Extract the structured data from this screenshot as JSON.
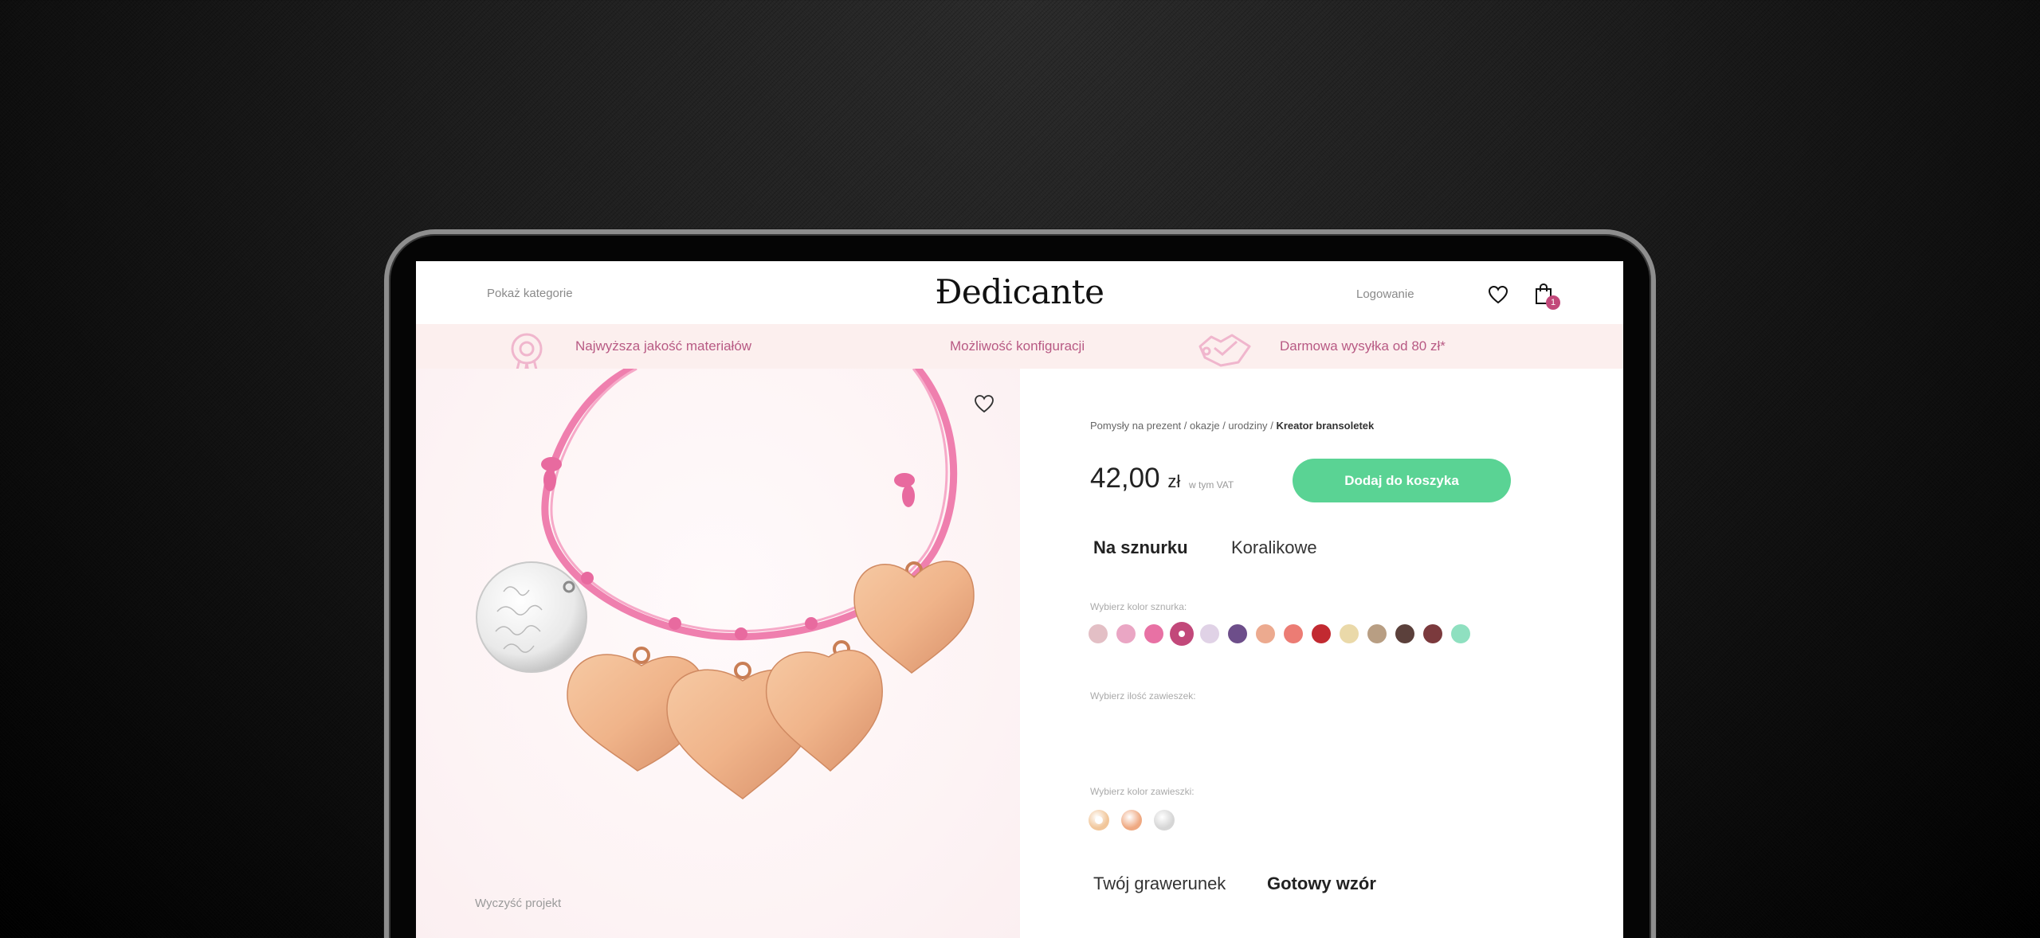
{
  "header": {
    "show_categories": "Pokaż kategorie",
    "logo": "Ðedicante",
    "login": "Logowanie",
    "cart_count": "1"
  },
  "benefits": [
    {
      "label": "Najwyższa jakość materiałów",
      "icon": "award-icon"
    },
    {
      "label": "Możliwość konfiguracji"
    },
    {
      "label": "Darmowa wysyłka od 80 zł*",
      "icon": "hands-icon"
    }
  ],
  "image": {
    "clear_project": "Wyczyść projekt"
  },
  "product": {
    "breadcrumb_path": "Pomysły na prezent / okazje / urodziny",
    "breadcrumb_sep": "/",
    "breadcrumb_current": "Kreator bransoletek",
    "price_value": "42,00",
    "price_currency": "zł",
    "vat_note": "w tym VAT",
    "add_to_cart": "Dodaj do koszyka",
    "type_tabs": [
      "Na sznurku",
      "Koralikowe"
    ],
    "cord_color_label": "Wybierz kolor sznurka:",
    "count_label": "Wybierz ilość zawieszek:",
    "pendant_color_label": "Wybierz kolor zawieszki:",
    "engraving_tabs": [
      "Twój grawerunek",
      "Gotowy wzór"
    ]
  },
  "cord_colors": [
    "#e3bfc5",
    "#eaa6c4",
    "#e871a4",
    "#c2487a",
    "#e0d2e6",
    "#6d4e8a",
    "#ecaa8f",
    "#ec7c74",
    "#c22a31",
    "#ead9a9",
    "#b89e83",
    "#5b403b",
    "#7b3a3d",
    "#8fe0c0"
  ],
  "cord_selected_index": 3,
  "pendant_colors": [
    "#f1c69a",
    "#efa982",
    "#d6d6d6"
  ],
  "pendant_selected_index": 0,
  "colors": {
    "accent_pink": "#c2487a",
    "cta_green": "#5ad394",
    "benefit_bar": "#fcefee"
  }
}
